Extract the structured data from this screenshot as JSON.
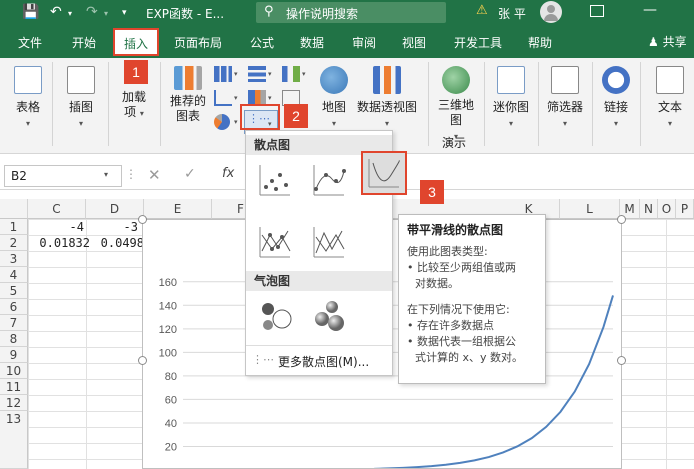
{
  "titlebar": {
    "title": "EXP函数 - E...",
    "search_placeholder": "操作说明搜索",
    "user": "张 平"
  },
  "tabs": [
    "文件",
    "开始",
    "插入",
    "页面布局",
    "公式",
    "数据",
    "审阅",
    "视图",
    "开发工具",
    "帮助"
  ],
  "share": "共享",
  "ribbon": {
    "table": "表格",
    "illustration": "插图",
    "addin_1": "加载",
    "addin_2": "项",
    "recommended_1": "推荐的",
    "recommended_2": "图表",
    "map": "地图",
    "pivotchart": "数据透视图",
    "map3d_1": "三维地",
    "map3d_2": "图",
    "demo": "演示",
    "sparkline": "迷你图",
    "filter": "筛选器",
    "link": "链接",
    "text": "文本"
  },
  "formulabar": {
    "namebox": "B2",
    "fx": "fx"
  },
  "sheet": {
    "columns": [
      "C",
      "D",
      "E",
      "F",
      "J",
      "K",
      "L",
      "M",
      "N",
      "O",
      "P"
    ],
    "rows": [
      "1",
      "2",
      "3",
      "4",
      "5",
      "6",
      "7",
      "8",
      "9",
      "10",
      "11",
      "12",
      "13"
    ],
    "cells": {
      "c1": "-4",
      "d1": "-3",
      "c2": "0.01832",
      "d2": "0.0498"
    }
  },
  "gallery": {
    "scatter_title": "散点图",
    "bubble_title": "气泡图",
    "more": "更多散点图(M)..."
  },
  "tooltip": {
    "title": "带平滑线的散点图",
    "lines": [
      "使用此图表类型:",
      "• 比较至少两组值或两",
      "对数据。",
      "",
      "在下列情况下使用它:",
      "• 存在许多数据点",
      "• 数据代表一组根据公",
      "式计算的 x、y 数对。"
    ]
  },
  "steps": [
    "1",
    "2",
    "3"
  ],
  "chart_data": {
    "type": "line",
    "yticks": [
      "160",
      "140",
      "120",
      "100",
      "80",
      "60",
      "40",
      "20"
    ],
    "ylim": [
      0,
      170
    ],
    "series": [
      {
        "x": [
          0.0,
          0.3,
          0.6,
          0.9,
          1.2,
          1.5,
          1.8,
          2.1,
          2.4,
          2.7,
          3.0,
          3.3,
          3.6,
          3.9,
          4.2,
          4.5,
          4.8,
          5.0
        ],
        "y": [
          1.0,
          1.35,
          1.82,
          2.46,
          3.32,
          4.48,
          6.05,
          8.17,
          11.0,
          14.9,
          20.1,
          27.1,
          36.6,
          49.4,
          66.7,
          90.0,
          121.5,
          148.4
        ]
      }
    ],
    "xlim": [
      -4,
      5
    ],
    "color": "#4f81bd"
  }
}
